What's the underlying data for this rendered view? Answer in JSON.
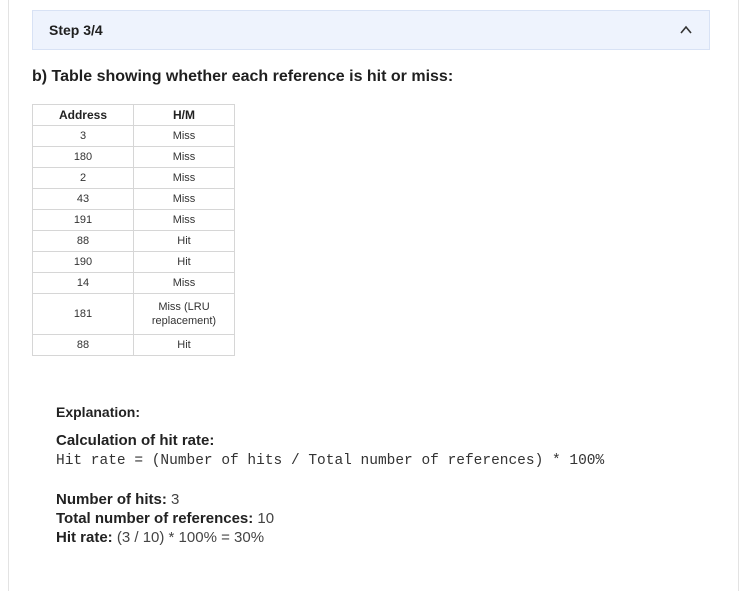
{
  "step": {
    "label": "Step 3/4"
  },
  "heading": "b) Table showing whether each reference is hit or miss:",
  "table": {
    "headers": [
      "Address",
      "H/M"
    ],
    "rows": [
      {
        "address": "3",
        "hm": "Miss"
      },
      {
        "address": "180",
        "hm": "Miss"
      },
      {
        "address": "2",
        "hm": "Miss"
      },
      {
        "address": "43",
        "hm": "Miss"
      },
      {
        "address": "191",
        "hm": "Miss"
      },
      {
        "address": "88",
        "hm": "Hit"
      },
      {
        "address": "190",
        "hm": "Hit"
      },
      {
        "address": "14",
        "hm": "Miss"
      },
      {
        "address": "181",
        "hm": "Miss (LRU replacement)"
      },
      {
        "address": "88",
        "hm": "Hit"
      }
    ]
  },
  "explanation": {
    "label": "Explanation:",
    "calc_title": "Calculation of hit rate:",
    "formula": "Hit rate = (Number of hits / Total number of references) * 100%",
    "hits_label": "Number of hits:",
    "hits_value": " 3",
    "total_label": "Total number of references:",
    "total_value": " 10",
    "rate_label": "Hit rate:",
    "rate_value": " (3 / 10) * 100% = 30%"
  }
}
